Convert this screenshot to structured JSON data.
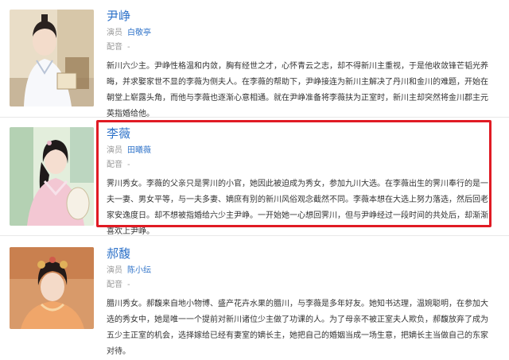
{
  "characters": [
    {
      "name": "尹峥",
      "actor_label": "演员",
      "actor": "白敬亭",
      "dubbing_label": "配音",
      "dubbing": "-",
      "description": "新川六少主。尹峥性格温和内敛，胸有经世之才，心怀青云之志，却不得新川主重视，于是他收敛锋芒韬光养晦，并求娶家世不显的李薇为侧夫人。在李薇的帮助下，尹峥接连为新川主解决了丹川和金川的难题，开始在朝堂上崭露头角，而他与李薇也逐渐心意相通。就在尹峥准备将李薇扶为正室时，新川主却突然将金川郡主元英指婚给他。"
    },
    {
      "name": "李薇",
      "actor_label": "演员",
      "actor": "田曦薇",
      "dubbing_label": "配音",
      "dubbing": "-",
      "description": "霁川秀女。李薇的父亲只是霁川的小官，她因此被迫成为秀女，参加九川大选。在李薇出生的霁川奉行的是一夫一妻、男女平等，与一夫多妻、嫡庶有别的新川风俗观念截然不同。李薇本想在大选上努力落选，然后回老家安逸度日。却不想被指婚给六少主尹峥。一开始她一心想回霁川，但与尹峥经过一段时间的共处后，却渐渐喜欢上尹峥。"
    },
    {
      "name": "郝馥",
      "actor_label": "演员",
      "actor": "陈小纭",
      "dubbing_label": "配音",
      "dubbing": "-",
      "description": "腊川秀女。郝馥来自地小物博、盛产花卉水果的腊川，与李薇是多年好友。她知书达理，温婉聪明，在参加大选的秀女中，她是唯一一个提前对新川诸位少主做了功课的人。为了母亲不被正室夫人欺负，郝馥放弃了成为五少主正室的机会，选择嫁给已经有妻室的嫡长主，她把自己的婚姻当成一场生意，把嫡长主当做自己的东家对待。"
    }
  ],
  "colors": {
    "link": "#2f73c9",
    "highlight_border": "#e01b24",
    "muted": "#999999"
  }
}
